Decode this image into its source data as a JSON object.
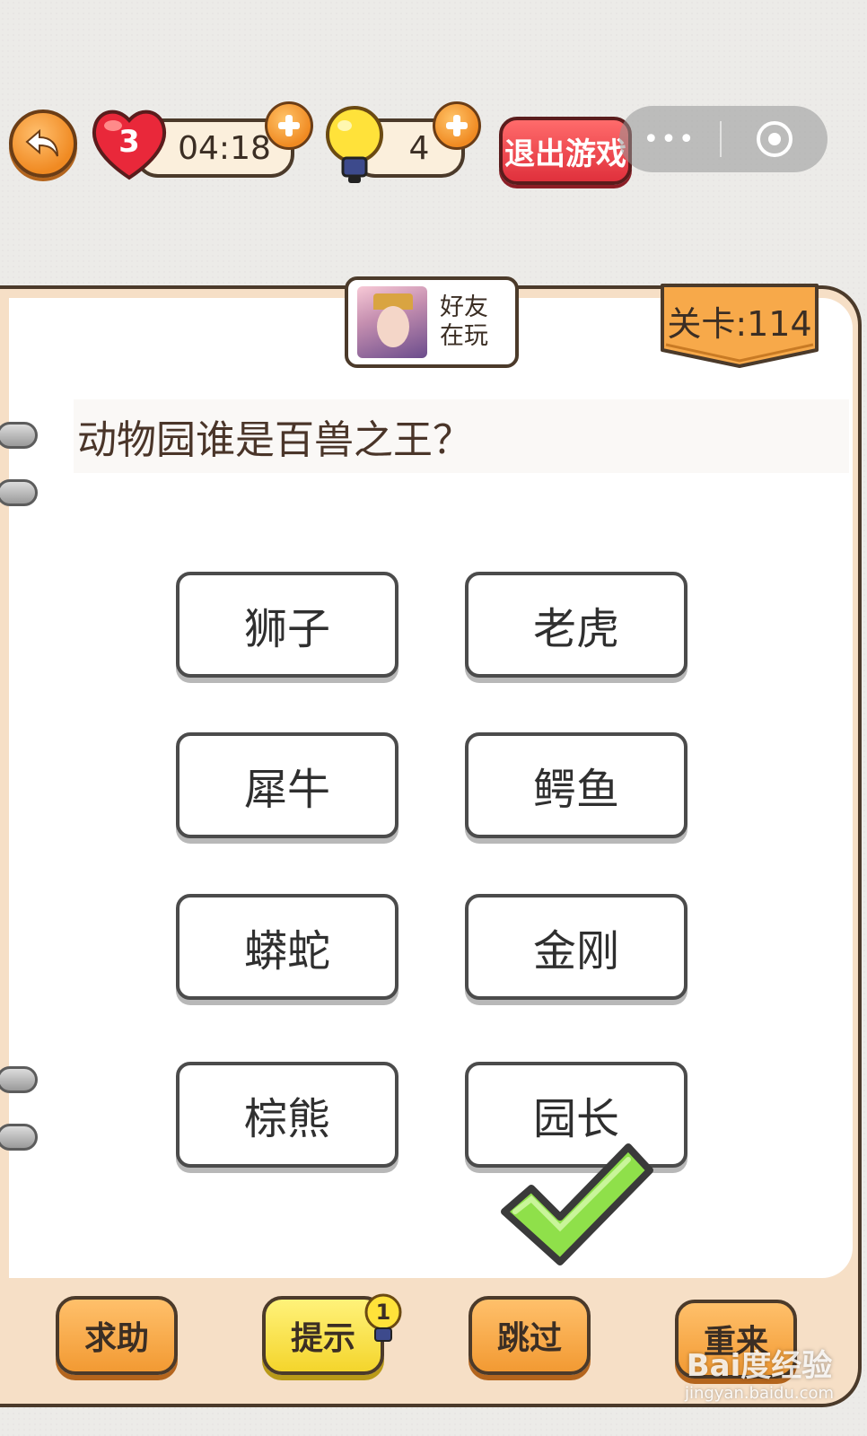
{
  "top_bar": {
    "lives": "3",
    "timer": "04:18",
    "hints_count": "4",
    "quit_label": "退出游戏",
    "more_label": "•••"
  },
  "friend_card": {
    "line1": "好友",
    "line2": "在玩"
  },
  "level_label": "关卡:114",
  "question": "动物园谁是百兽之王？",
  "answers": [
    "狮子",
    "老虎",
    "犀牛",
    "鳄鱼",
    "蟒蛇",
    "金刚",
    "棕熊",
    "园长"
  ],
  "bottom_buttons": {
    "help": "求助",
    "hint": "提示",
    "hint_badge": "1",
    "skip": "跳过",
    "restart": "重来"
  },
  "watermark": {
    "brand": "Bai度经验",
    "url": "jingyan.baidu.com"
  },
  "colors": {
    "accent_orange": "#f29a33",
    "quit_red": "#e0303c",
    "check_green": "#8fe04a",
    "outline": "#4b3a2a"
  }
}
